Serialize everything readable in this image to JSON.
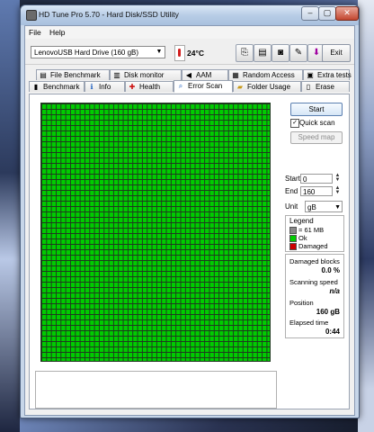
{
  "window": {
    "title": "HD Tune Pro 5.70 - Hard Disk/SSD Utility"
  },
  "menu": {
    "file": "File",
    "help": "Help"
  },
  "toolbar": {
    "drive": "LenovoUSB Hard Drive (160 gB)",
    "temperature": "24°C",
    "exit_label": "Exit"
  },
  "tabs_row1": [
    {
      "label": "File Benchmark",
      "icon": "file-benchmark-icon",
      "glyph": "▤"
    },
    {
      "label": "Disk monitor",
      "icon": "disk-monitor-icon",
      "glyph": "▥"
    },
    {
      "label": "AAM",
      "icon": "speaker-icon",
      "glyph": "◀"
    },
    {
      "label": "Random Access",
      "icon": "random-access-icon",
      "glyph": "▦"
    },
    {
      "label": "Extra tests",
      "icon": "extra-tests-icon",
      "glyph": "▣"
    }
  ],
  "tabs_row2": [
    {
      "label": "Benchmark",
      "icon": "benchmark-icon",
      "glyph": "▮"
    },
    {
      "label": "Info",
      "icon": "info-icon",
      "glyph": "ℹ"
    },
    {
      "label": "Health",
      "icon": "health-cross-icon",
      "glyph": "✚"
    },
    {
      "label": "Error Scan",
      "icon": "magnifier-icon",
      "glyph": "⌕"
    },
    {
      "label": "Folder Usage",
      "icon": "folder-icon",
      "glyph": "▰"
    },
    {
      "label": "Erase",
      "icon": "trash-icon",
      "glyph": "▯"
    }
  ],
  "active_tab": "Error Scan",
  "controls": {
    "start_label": "Start",
    "quick_scan_label": "Quick scan",
    "quick_scan_checked": true,
    "speed_map_label": "Speed map",
    "start_field_label": "Start",
    "start_value": "0",
    "end_field_label": "End",
    "end_value": "160",
    "unit_label": "Unit",
    "unit_value": "gB"
  },
  "legend": {
    "title": "Legend",
    "block_size": "= 61 MB",
    "ok": "Ok",
    "damaged": "Damaged"
  },
  "stats": {
    "damaged_label": "Damaged blocks",
    "damaged_value": "0.0 %",
    "speed_label": "Scanning speed",
    "speed_value": "n/a",
    "position_label": "Position",
    "position_value": "160 gB",
    "elapsed_label": "Elapsed time",
    "elapsed_value": "0:44"
  },
  "colors": {
    "ok_block": "#00cc00",
    "damaged_block": "#cc0000",
    "grid_line": "#1f3a1f"
  }
}
